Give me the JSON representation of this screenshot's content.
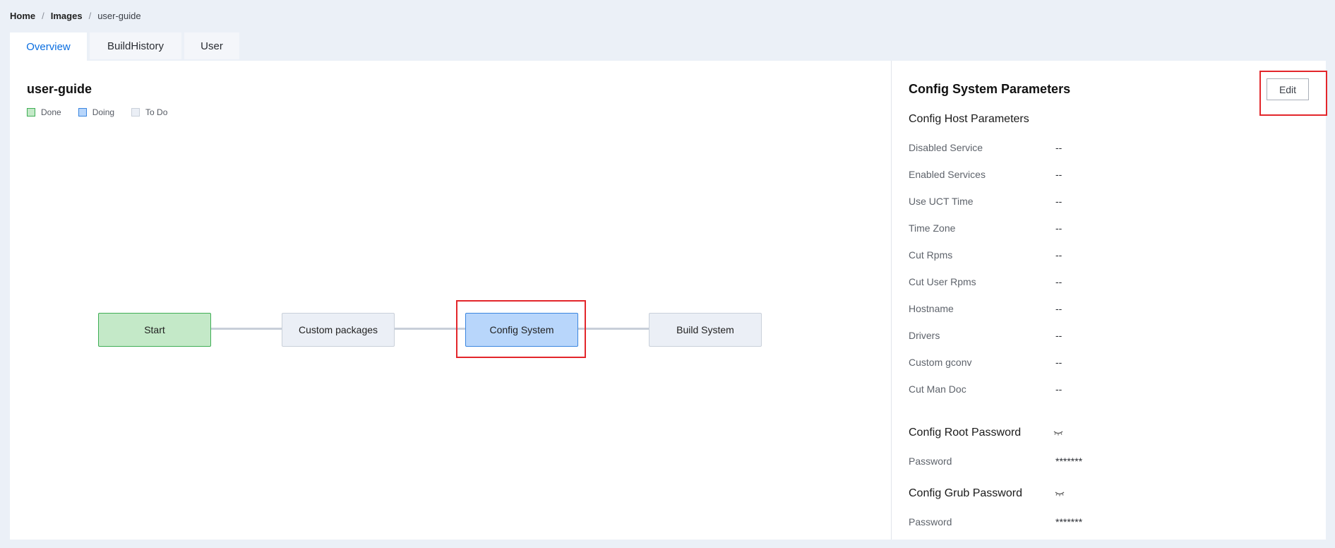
{
  "breadcrumb": {
    "home": "Home",
    "images": "Images",
    "current": "user-guide"
  },
  "tabs": [
    {
      "label": "Overview"
    },
    {
      "label": "BuildHistory"
    },
    {
      "label": "User"
    }
  ],
  "overview": {
    "title": "user-guide",
    "legend": {
      "done": "Done",
      "doing": "Doing",
      "todo": "To Do"
    },
    "flow": {
      "start": "Start",
      "custom_packages": "Custom packages",
      "config_system": "Config System",
      "build_system": "Build System"
    }
  },
  "config_panel": {
    "title": "Config System Parameters",
    "edit_label": "Edit",
    "host_section": "Config Host Parameters",
    "host_params": [
      {
        "label": "Disabled Service",
        "value": "--"
      },
      {
        "label": "Enabled Services",
        "value": "--"
      },
      {
        "label": "Use UCT Time",
        "value": "--"
      },
      {
        "label": "Time Zone",
        "value": "--"
      },
      {
        "label": "Cut Rpms",
        "value": "--"
      },
      {
        "label": "Cut User Rpms",
        "value": "--"
      },
      {
        "label": "Hostname",
        "value": "--"
      },
      {
        "label": "Drivers",
        "value": "--"
      },
      {
        "label": "Custom gconv",
        "value": "--"
      },
      {
        "label": "Cut Man Doc",
        "value": "--"
      }
    ],
    "root_password_section": "Config Root Password",
    "root_password": {
      "label": "Password",
      "value": "*******"
    },
    "grub_password_section": "Config Grub Password",
    "grub_password": {
      "label": "Password",
      "value": "*******"
    }
  },
  "colors": {
    "accent": "#0a6ee0",
    "done_fill": "#c4e9c8",
    "doing_fill": "#b8d6fb",
    "todo_fill": "#ebeff6",
    "highlight": "#e3262b"
  }
}
